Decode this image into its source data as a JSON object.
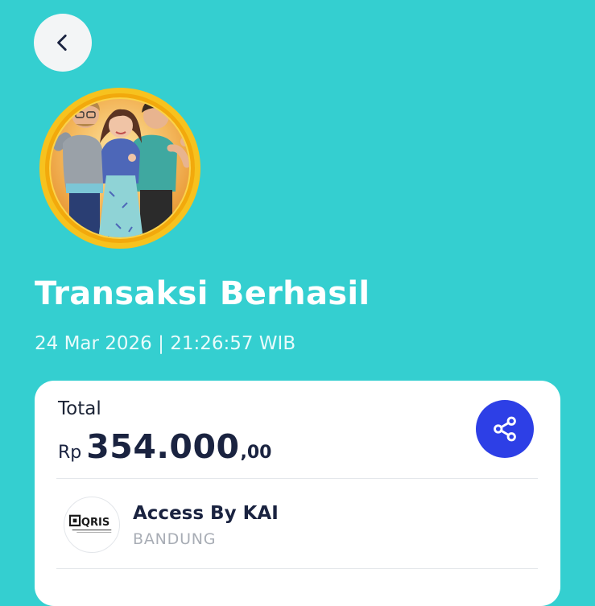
{
  "header": {
    "back_icon": "chevron-left-icon"
  },
  "hero": {
    "illustration": "three-people-celebrating-medal",
    "medal_color": "#F7C21E"
  },
  "status": {
    "title": "Transaksi Berhasil",
    "timestamp": "24 Mar 2026 | 21:26:57 WIB"
  },
  "summary": {
    "total_label": "Total",
    "currency": "Rp",
    "amount_main": "354.000",
    "amount_decimal": ",00",
    "share_icon": "share-icon"
  },
  "merchant": {
    "logo_icon": "qris-logo-icon",
    "logo_text": "QRIS",
    "name": "Access By KAI",
    "city": "BANDUNG"
  },
  "colors": {
    "background": "#34CFD0",
    "primary_text": "#1A2340",
    "share_button": "#2D3FE6",
    "card": "#FFFFFF"
  }
}
